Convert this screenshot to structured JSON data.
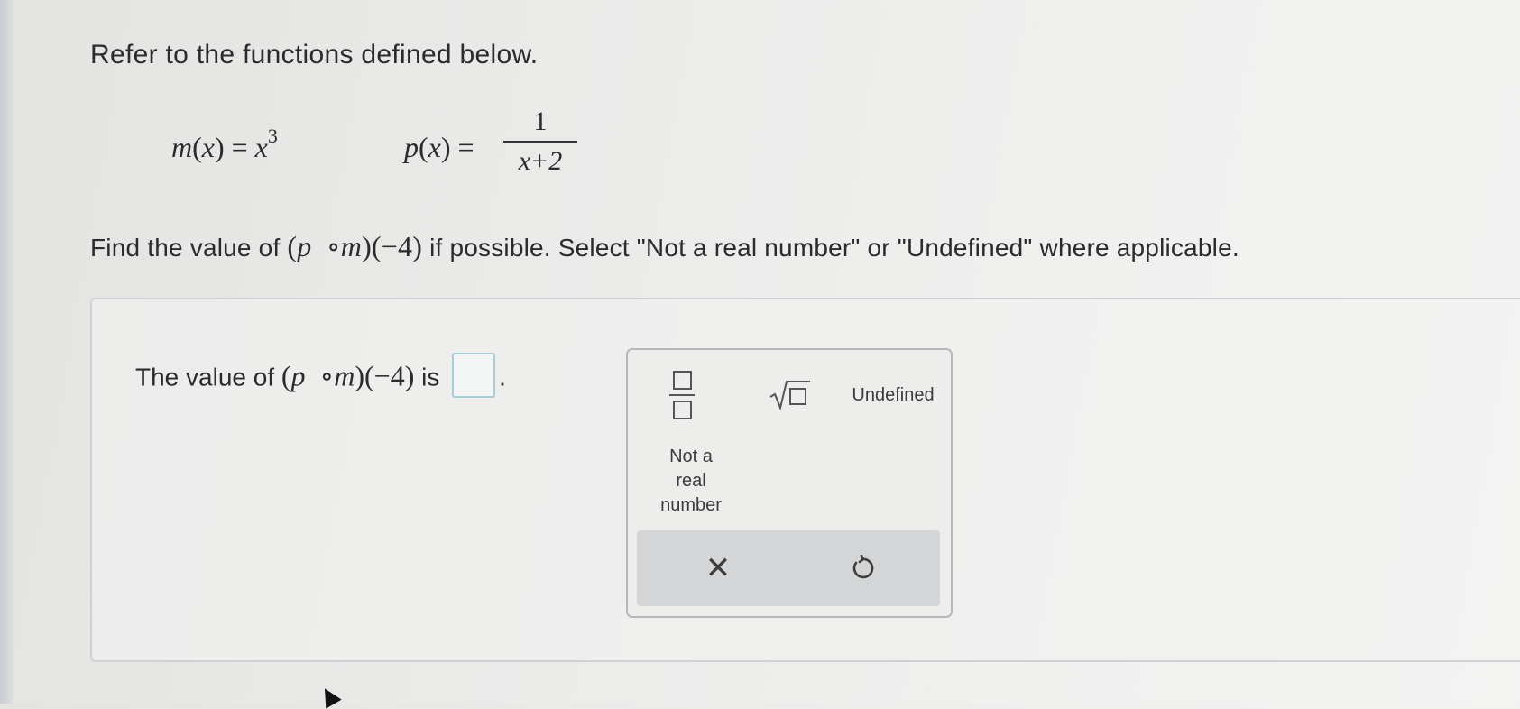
{
  "question": {
    "intro": "Refer to the functions defined below.",
    "m_def": {
      "name": "m",
      "var": "x",
      "base": "x",
      "exponent": "3"
    },
    "p_def": {
      "name": "p",
      "var": "x",
      "numerator": "1",
      "denominator": "x+2"
    },
    "instruction_prefix": "Find the value of",
    "composition": {
      "outer": "p",
      "op": "∘",
      "inner": "m",
      "arg": "−4"
    },
    "instruction_suffix": "if possible. Select \"Not a real number\" or \"Undefined\" where applicable."
  },
  "answer": {
    "prefix": "The value of",
    "middle": "is",
    "suffix": ".",
    "value": ""
  },
  "keypad": {
    "fraction_label": "",
    "sqrt_label": "",
    "undefined_label": "Undefined",
    "not_real_label": "Not a\nreal\nnumber",
    "clear_glyph": "✕",
    "undo_icon": "undo-icon"
  }
}
